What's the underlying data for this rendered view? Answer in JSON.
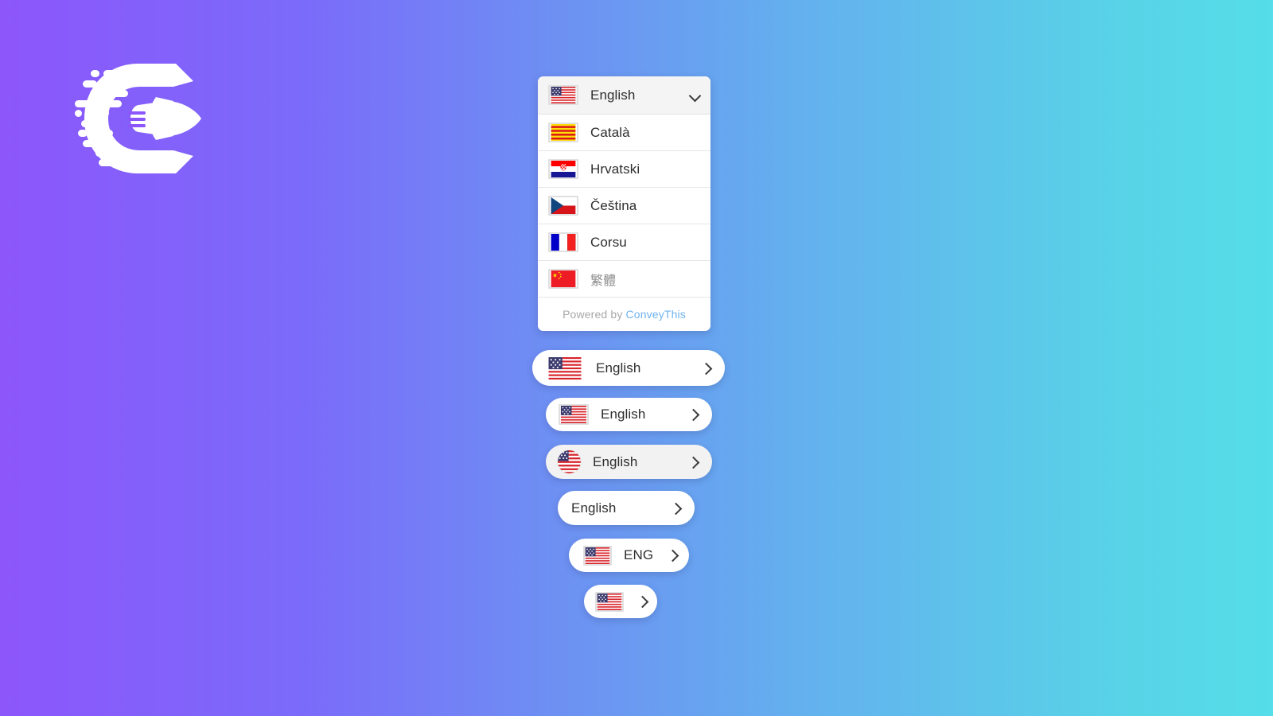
{
  "brand": {
    "logo_name": "conveythis-rocket-logo",
    "name": "ConveyThis"
  },
  "theme": {
    "gradient_start": "#8c56fb",
    "gradient_end": "#55dde9",
    "panel_bg": "#ffffff",
    "header_bg": "#f4f4f4",
    "muted_text": "#a8a8a8",
    "brand_link": "#6fb4ef",
    "text": "#2e2e2e"
  },
  "dropdown": {
    "selected": {
      "label": "English",
      "flag": "us-flag",
      "chevron": "chevron-down-icon"
    },
    "options": [
      {
        "label": "Català",
        "flag": "catalonia-flag"
      },
      {
        "label": "Hrvatski",
        "flag": "croatia-flag"
      },
      {
        "label": "Čeština",
        "flag": "czech-republic-flag"
      },
      {
        "label": "Corsu",
        "flag": "france-flag"
      },
      {
        "label": "繁體",
        "flag": "china-flag"
      }
    ],
    "footer": {
      "prefix": "Powered by",
      "brand": "ConveyThis"
    }
  },
  "buttons": [
    {
      "label": "English",
      "flag": "us-flag",
      "flag_style": "plain",
      "chevron": "chevron-right-icon",
      "bg": "#ffffff"
    },
    {
      "label": "English",
      "flag": "us-flag",
      "flag_style": "bordered",
      "chevron": "chevron-right-icon",
      "bg": "#ffffff"
    },
    {
      "label": "English",
      "flag": "us-flag-round",
      "flag_style": "round",
      "chevron": "chevron-right-icon",
      "bg": "#f2f2f2"
    },
    {
      "label": "English",
      "flag": null,
      "flag_style": "none",
      "chevron": "chevron-right-icon",
      "bg": "#ffffff"
    },
    {
      "label": "ENG",
      "flag": "us-flag",
      "flag_style": "bordered",
      "chevron": "chevron-right-icon",
      "bg": "#ffffff"
    },
    {
      "label": "",
      "flag": "us-flag",
      "flag_style": "bordered",
      "chevron": "chevron-right-icon",
      "bg": "#ffffff"
    }
  ]
}
